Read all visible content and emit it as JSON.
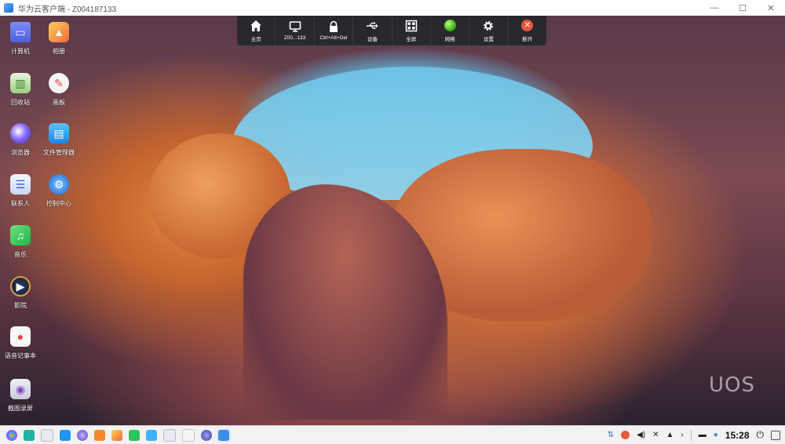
{
  "window": {
    "title": "华为云客户端 - Z004187133",
    "minimize": "—",
    "maximize": "☐",
    "close": "✕"
  },
  "toolbar": {
    "items": [
      {
        "label": "主页",
        "icon": "home-icon"
      },
      {
        "label": "Z00...133",
        "icon": "monitor-icon"
      },
      {
        "label": "Ctrl+Alt+Del",
        "icon": "lock-icon"
      },
      {
        "label": "设备",
        "icon": "usb-icon"
      },
      {
        "label": "全屏",
        "icon": "fullscreen-icon"
      },
      {
        "label": "网络",
        "icon": "network-status-icon"
      },
      {
        "label": "设置",
        "icon": "gear-icon"
      },
      {
        "label": "断开",
        "icon": "disconnect-icon"
      }
    ]
  },
  "desktop": {
    "icons": [
      {
        "label": "计算机",
        "icon": "computer-icon"
      },
      {
        "label": "相册",
        "icon": "photos-icon"
      },
      {
        "label": "回收站",
        "icon": "trash-icon"
      },
      {
        "label": "画板",
        "icon": "drawing-board-icon"
      },
      {
        "label": "浏览器",
        "icon": "browser-icon"
      },
      {
        "label": "文件管理器",
        "icon": "file-manager-icon"
      },
      {
        "label": "联系人",
        "icon": "contacts-icon"
      },
      {
        "label": "控制中心",
        "icon": "control-center-icon"
      },
      {
        "label": "音乐",
        "icon": "music-icon"
      },
      {
        "label": "影院",
        "icon": "movie-icon"
      },
      {
        "label": "语音记事本",
        "icon": "voice-notes-icon"
      },
      {
        "label": "截图录屏",
        "icon": "screenshot-icon"
      }
    ],
    "watermark": "UOS"
  },
  "taskbar": {
    "clock": "15:28"
  }
}
